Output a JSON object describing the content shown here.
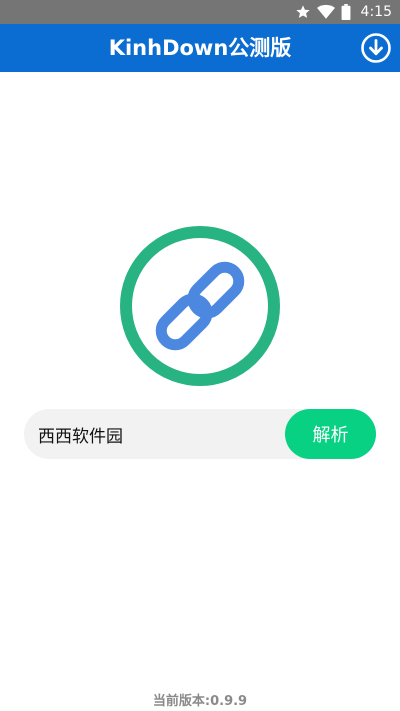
{
  "status_bar": {
    "time": "4:15",
    "icons": [
      "star-icon",
      "wifi-icon",
      "battery-icon"
    ]
  },
  "header": {
    "title": "KinhDown公测版",
    "download_icon": "download-circle-icon"
  },
  "logo": {
    "icon": "link-icon",
    "ring_color": "#28b383",
    "link_color": "#4c88e0"
  },
  "search": {
    "value": "西西软件园",
    "button_label": "解析"
  },
  "footer": {
    "version": "当前版本:0.9.9"
  },
  "colors": {
    "header_bg": "#0b6cd1",
    "status_bar_bg": "#757575",
    "accent_button": "#08d184",
    "input_bg": "#f2f2f3"
  }
}
